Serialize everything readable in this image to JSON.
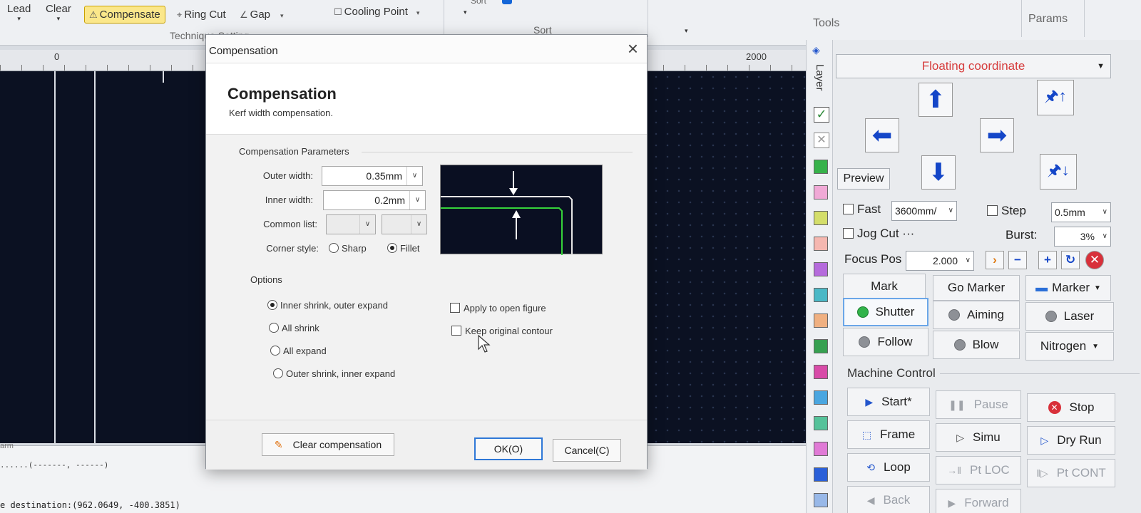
{
  "ribbon": {
    "lead": "Lead",
    "clear": "Clear",
    "compensate": "Compensate",
    "ring_cut": "Ring Cut",
    "gap": "Gap",
    "cooling_point": "Cooling Point",
    "group_technique": "Technique Setting",
    "group_sort": "Sort",
    "group_tools": "Tools",
    "group_params": "Params",
    "sort_top": "Sort"
  },
  "canvas": {
    "ruler_zero": "0",
    "ruler_end": "2000",
    "toolbar_tag": "arm"
  },
  "console": {
    "line1": "......(-------,   ------)",
    "line2": "e destination:(962.0649, -400.3851)"
  },
  "layer": {
    "title": "Layer",
    "colors": [
      "#36b24a",
      "#f0a9d6",
      "#d4de6a",
      "#f5b7b0",
      "#b56bdc",
      "#4ab8c6",
      "#f0b081",
      "#36a050",
      "#d84ba8",
      "#4aa6e0",
      "#55c29a",
      "#e07ad6",
      "#2a5fd8",
      "#98b8e8"
    ]
  },
  "panel": {
    "coordinate": "Floating coordinate",
    "preview": "Preview",
    "fast": "Fast",
    "fast_speed": "3600mm/",
    "step": "Step",
    "step_value": "0.5mm",
    "jog_cut": "Jog Cut ···",
    "burst": "Burst:",
    "burst_value": "3%",
    "focus_pos": "Focus Pos",
    "focus_value": "2.000",
    "mark": "Mark",
    "go_marker": "Go Marker",
    "marker": "Marker",
    "shutter": "Shutter",
    "aiming": "Aiming",
    "laser": "Laser",
    "follow": "Follow",
    "blow": "Blow",
    "nitrogen": "Nitrogen",
    "machine_control": "Machine Control",
    "start": "Start*",
    "pause": "Pause",
    "stop": "Stop",
    "frame": "Frame",
    "simu": "Simu",
    "dry_run": "Dry Run",
    "loop": "Loop",
    "pt_loc": "Pt LOC",
    "pt_cont": "Pt CONT",
    "back": "Back",
    "forward": "Forward"
  },
  "dialog": {
    "window_title": "Compensation",
    "heading": "Compensation",
    "subtitle": "Kerf width compensation.",
    "params_group": "Compensation Parameters",
    "outer_width_label": "Outer width:",
    "outer_width_value": "0.35mm",
    "inner_width_label": "Inner width:",
    "inner_width_value": "0.2mm",
    "common_list_label": "Common list:",
    "corner_style_label": "Corner style:",
    "sharp": "Sharp",
    "fillet": "Fillet",
    "options_group": "Options",
    "opt_inner_shrink": "Inner shrink, outer expand",
    "opt_all_shrink": "All shrink",
    "opt_all_expand": "All expand",
    "opt_outer_shrink": "Outer shrink, inner expand",
    "apply_open": "Apply to open figure",
    "keep_original": "Keep original contour",
    "clear_comp": "Clear compensation",
    "ok": "OK(O)",
    "cancel": "Cancel(C)"
  }
}
